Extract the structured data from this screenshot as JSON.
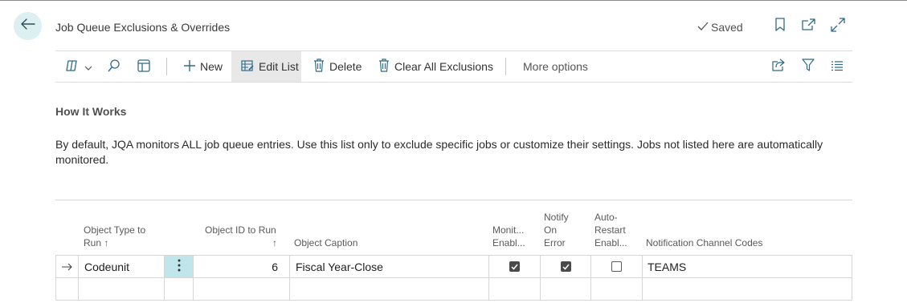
{
  "header": {
    "title": "Job Queue Exclusions & Overrides",
    "saved_label": "Saved",
    "icons": [
      "back-arrow-icon",
      "bookmark-icon",
      "open-new-window-icon",
      "expand-icon"
    ]
  },
  "toolbar": {
    "new_label": "New",
    "edit_list_label": "Edit List",
    "delete_label": "Delete",
    "clear_all_label": "Clear All Exclusions",
    "more_options_label": "More options"
  },
  "section": {
    "title": "How It Works",
    "description": "By default, JQA monitors ALL job queue entries. Use this list only to exclude specific jobs or customize their settings. Jobs not listed here are automatically monitored."
  },
  "columns": {
    "object_type": [
      "Object Type to",
      "Run ↑"
    ],
    "object_id": [
      "Object ID to Run",
      "↑"
    ],
    "object_caption": "Object Caption",
    "monitoring": [
      "Monit...",
      "Enabl..."
    ],
    "notify": [
      "Notify",
      "On",
      "Error"
    ],
    "auto_restart": [
      "Auto-",
      "Restart",
      "Enabl..."
    ],
    "notification_channels": "Notification Channel Codes"
  },
  "rows": [
    {
      "object_type": "Codeunit",
      "object_id": "6",
      "object_caption": "Fiscal Year-Close",
      "monitoring_enabled": true,
      "notify_on_error": true,
      "auto_restart_enabled": false,
      "notification_channels": "TEAMS"
    }
  ],
  "colors": {
    "accent_bg": "#dceff1",
    "selected_cell": "#bfe6ea",
    "checkbox_on": "#4a4a4a"
  }
}
